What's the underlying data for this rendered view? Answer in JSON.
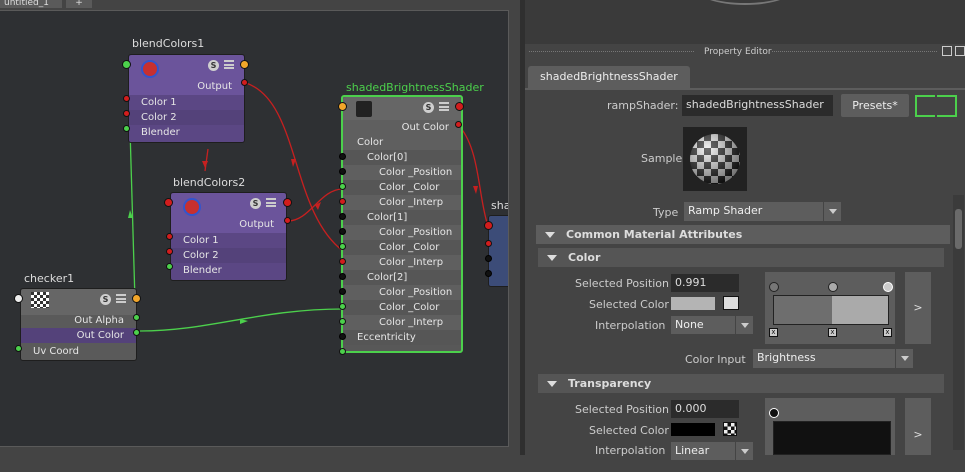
{
  "graph": {
    "tabs": [
      {
        "label": "untitled_1"
      },
      {
        "label": "+"
      }
    ]
  },
  "nodes": {
    "blend1": {
      "title": "blendColors1",
      "output": "Output",
      "color1": "Color 1",
      "color2": "Color 2",
      "blender": "Blender"
    },
    "blend2": {
      "title": "blendColors2",
      "output": "Output",
      "color1": "Color 1",
      "color2": "Color 2",
      "blender": "Blender"
    },
    "checker": {
      "title": "checker1",
      "out_alpha": "Out Alpha",
      "out_color": "Out Color",
      "uv": "Uv Coord"
    },
    "shaded": {
      "title": "shadedBrightnessShader",
      "out_color": "Out Color",
      "color": "Color",
      "c0": "Color[0]",
      "c1": "Color[1]",
      "c2": "Color[2]",
      "pos": "Color _Position",
      "col": "Color _Color",
      "interp": "Color _Interp",
      "ecc": "Eccentricity"
    },
    "partial": {
      "title": "sha"
    }
  },
  "pe": {
    "title": "Property Editor",
    "tab": "shadedBrightnessShader",
    "type_label": "rampShader:",
    "name_value": "shadedBrightnessShader",
    "presets": "Presets*",
    "sample_label": "Sample",
    "type_field_label": "Type",
    "type_value": "Ramp Shader",
    "sections": {
      "common": "Common Material Attributes",
      "color": "Color",
      "transparency": "Transparency"
    },
    "color": {
      "sel_pos_label": "Selected Position",
      "sel_pos": "0.991",
      "sel_color_label": "Selected Color",
      "interp_label": "Interpolation",
      "interp": "None",
      "input_label": "Color Input",
      "input": "Brightness",
      "ramp_btn": ">"
    },
    "transparency": {
      "sel_pos_label": "Selected Position",
      "sel_pos": "0.000",
      "sel_color_label": "Selected Color",
      "interp_label": "Interpolation",
      "interp": "Linear",
      "ramp_btn": ">"
    }
  }
}
